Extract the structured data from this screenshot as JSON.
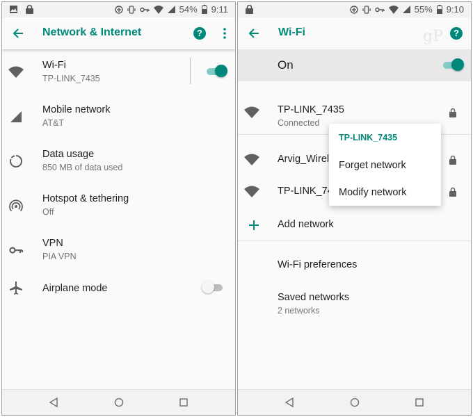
{
  "left": {
    "status": {
      "battery": "54%",
      "time": "9:11"
    },
    "header": {
      "title": "Network & Internet"
    },
    "items": [
      {
        "title": "Wi-Fi",
        "subtitle": "TP-LINK_7435",
        "icon": "wifi-icon",
        "toggle": "on"
      },
      {
        "title": "Mobile network",
        "subtitle": "AT&T",
        "icon": "cell-signal-icon"
      },
      {
        "title": "Data usage",
        "subtitle": "850 MB of data used",
        "icon": "data-usage-icon"
      },
      {
        "title": "Hotspot & tethering",
        "subtitle": "Off",
        "icon": "hotspot-icon"
      },
      {
        "title": "VPN",
        "subtitle": "PIA VPN",
        "icon": "vpn-key-icon"
      },
      {
        "title": "Airplane mode",
        "icon": "airplane-icon",
        "toggle": "off"
      }
    ]
  },
  "right": {
    "status": {
      "battery": "55%",
      "time": "9:10"
    },
    "header": {
      "title": "Wi-Fi"
    },
    "master": {
      "label": "On",
      "toggle": "on"
    },
    "networks": [
      {
        "name": "TP-LINK_7435",
        "status": "Connected",
        "icon": "wifi-icon",
        "locked": true
      },
      {
        "name": "Arvig_Wirel",
        "icon": "wifi-icon",
        "locked": true
      },
      {
        "name": "TP-LINK_74",
        "icon": "wifi-icon",
        "locked": true
      }
    ],
    "add_network": "Add network",
    "preferences": "Wi-Fi preferences",
    "saved": {
      "title": "Saved networks",
      "subtitle": "2 networks"
    },
    "popup": {
      "title": "TP-LINK_7435",
      "options": [
        "Forget network",
        "Modify network"
      ]
    },
    "watermark": "gP"
  },
  "colors": {
    "accent": "#00897b",
    "accent_light": "#80cbc4",
    "text_primary": "#212121",
    "text_secondary": "#757575"
  }
}
